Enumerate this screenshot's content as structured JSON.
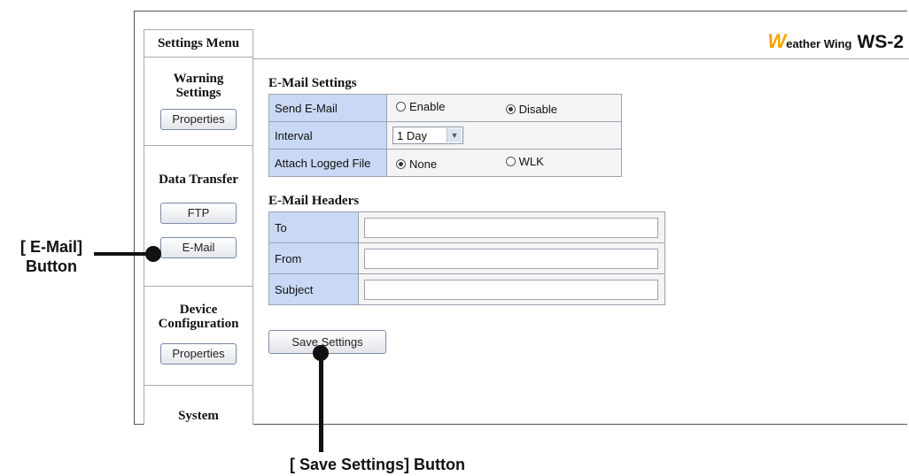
{
  "sidebar": {
    "title": "Settings Menu",
    "sections": [
      {
        "heading_line1": "Warning",
        "heading_line2": "Settings",
        "buttons": [
          "Properties"
        ]
      },
      {
        "heading_line1": "Data Transfer",
        "buttons": [
          "FTP",
          "E-Mail"
        ]
      },
      {
        "heading_line1": "Device",
        "heading_line2": "Configuration",
        "buttons": [
          "Properties"
        ]
      },
      {
        "heading_line1": "System"
      }
    ]
  },
  "header": {
    "logo_initial": "W",
    "logo_rest": "eather Wing",
    "model": "WS-2",
    "brand_color": "#f5a300"
  },
  "email_settings": {
    "title": "E-Mail Settings",
    "send_label": "Send E-Mail",
    "send_options": [
      "Enable",
      "Disable"
    ],
    "send_selected": "Disable",
    "interval_label": "Interval",
    "interval_value": "1 Day",
    "attach_label": "Attach Logged File",
    "attach_options": [
      "None",
      "WLK"
    ],
    "attach_selected": "None"
  },
  "email_headers": {
    "title": "E-Mail Headers",
    "to_label": "To",
    "from_label": "From",
    "subject_label": "Subject",
    "to_value": "",
    "from_value": "",
    "subject_value": ""
  },
  "save_label": "Save Settings",
  "annotations": {
    "email_line1": "[ E-Mail]",
    "email_line2": "Button",
    "save": "[ Save Settings] Button"
  },
  "colors": {
    "label_cell_bg": "#c9d9f5"
  }
}
